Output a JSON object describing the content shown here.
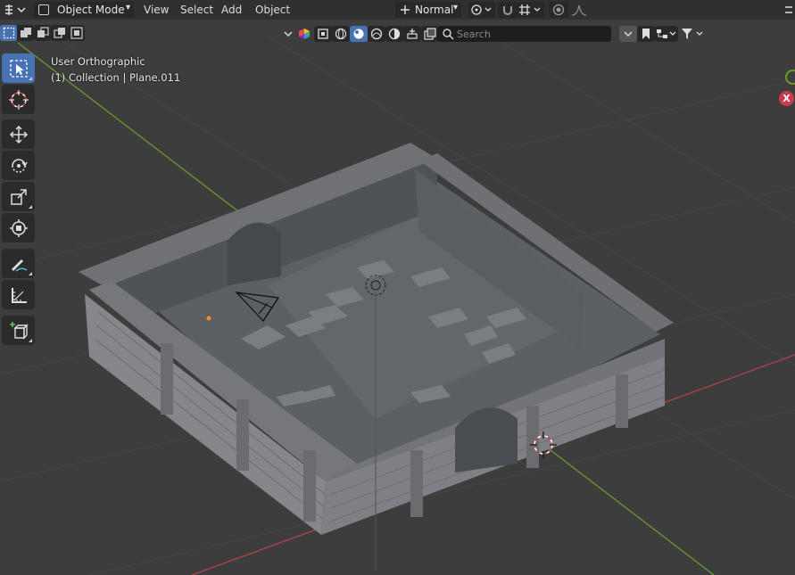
{
  "header": {
    "mode": "Object Mode",
    "menus": [
      "View",
      "Select",
      "Add",
      "Object"
    ],
    "orientation": "Normal"
  },
  "toolbar": {
    "search_placeholder": "Search"
  },
  "viewport": {
    "view_name": "User Orthographic",
    "collection_info": "(1) Collection | Plane.011"
  },
  "gizmo": {
    "x_label": "X"
  },
  "colors": {
    "accent": "#4772b3",
    "x_axis": "#ca3a4a",
    "y_axis": "#6a9a2a",
    "background": "#3d3d3d"
  },
  "icons": {
    "editor_type": "editor-type-icon",
    "tools": [
      "select-box-icon",
      "cursor-icon",
      "move-icon",
      "rotate-icon",
      "scale-icon",
      "transform-icon",
      "annotate-icon",
      "measure-icon",
      "add-cube-icon"
    ]
  }
}
